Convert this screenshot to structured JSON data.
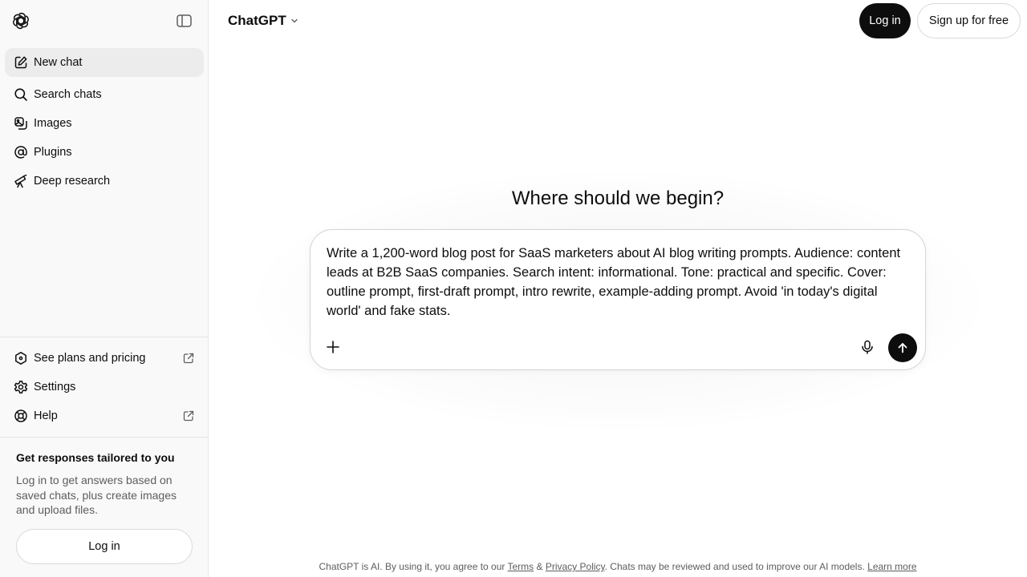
{
  "sidebar": {
    "items": [
      {
        "label": "New chat",
        "icon": "new-chat-icon"
      },
      {
        "label": "Search chats",
        "icon": "search-icon"
      },
      {
        "label": "Images",
        "icon": "images-icon"
      },
      {
        "label": "Plugins",
        "icon": "plugins-icon"
      },
      {
        "label": "Deep research",
        "icon": "telescope-icon"
      }
    ],
    "bottom_items": [
      {
        "label": "See plans and pricing",
        "icon": "hexagon-icon"
      },
      {
        "label": "Settings",
        "icon": "gear-icon"
      },
      {
        "label": "Help",
        "icon": "lifebuoy-icon"
      }
    ],
    "promo": {
      "title": "Get responses tailored to you",
      "text": "Log in to get answers based on saved chats, plus create images and upload files.",
      "login_label": "Log in"
    }
  },
  "header": {
    "model_label": "ChatGPT",
    "login_label": "Log in",
    "signup_label": "Sign up for free"
  },
  "main": {
    "headline": "Where should we begin?",
    "prompt_text": "Write a 1,200-word blog post for SaaS marketers about AI blog writing prompts. Audience: content leads at B2B SaaS companies. Search intent: informational. Tone: practical and specific. Cover: outline prompt, first-draft prompt, intro rewrite, example-adding prompt. Avoid 'in today's digital world' and fake stats."
  },
  "footer": {
    "prefix": "ChatGPT is AI. By using it, you agree to our ",
    "terms": "Terms",
    "amp": " & ",
    "privacy": "Privacy Policy",
    "middle": ". Chats may be reviewed and used to improve our AI models. ",
    "learn_more": "Learn more"
  },
  "colors": {
    "accent": "#0d0d0d",
    "sidebar_bg": "#f9f9f9",
    "active_item_bg": "#ececec",
    "muted_text": "#5d5d5d"
  }
}
